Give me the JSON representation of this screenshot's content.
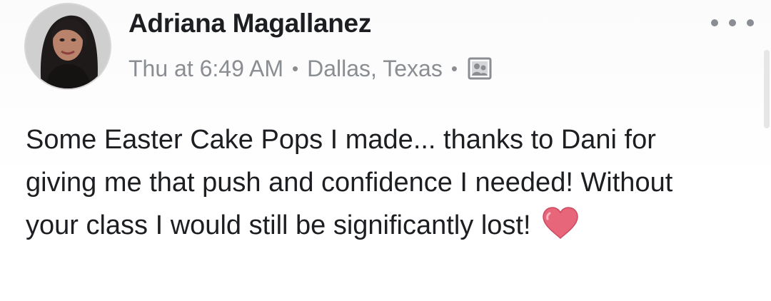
{
  "post": {
    "author": "Adriana Magallanez",
    "time": "Thu at 6:49 AM",
    "location": "Dallas, Texas",
    "separator": "•",
    "privacy_icon": "photo-audience-icon",
    "more_icon": "more-options-icon",
    "text": "Some Easter Cake Pops I made... thanks to Dani for giving me that push and confidence I needed! Without your class I would still be significantly lost!",
    "emoji": "heart-emoji",
    "colors": {
      "author": "#1c1e21",
      "meta": "#8a8d91",
      "heart": "#e8667a"
    }
  }
}
